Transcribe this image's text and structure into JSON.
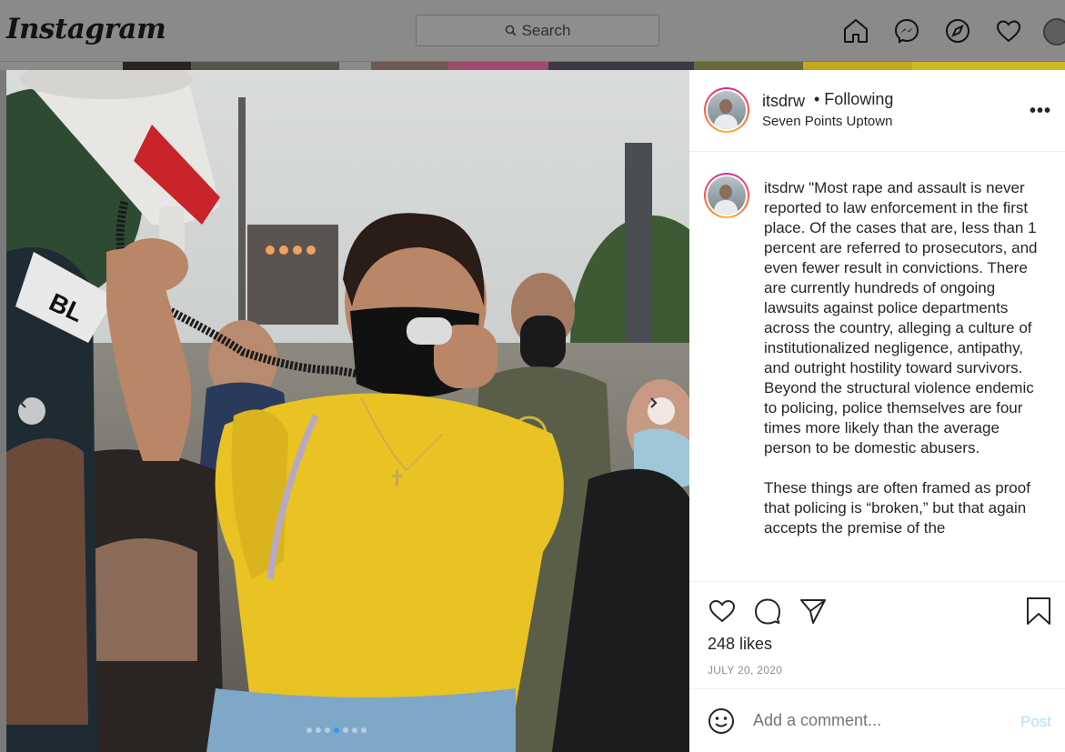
{
  "nav": {
    "logo": "Instagram",
    "search_placeholder": "Search",
    "icons": [
      "home-icon",
      "messenger-icon",
      "explore-icon",
      "heart-icon",
      "profile-avatar"
    ]
  },
  "post": {
    "username": "itsdrw",
    "following_label": "• Following",
    "location": "Seven Points Uptown",
    "more_label": "•••",
    "caption_username": "itsdrw",
    "caption_text": " \"Most rape and assault is never reported to law enforcement in the first place. Of the cases that are, less than 1 percent are referred to prosecutors, and even fewer result in convictions. There are currently hundreds of ongoing lawsuits against police departments across the country, alleging a culture of institutionalized negligence, antipathy, and outright hostility toward survivors. Beyond the structural violence endemic to policing, police themselves are four times more likely than the average person to be domestic abusers.\n\nThese things are often framed as proof that policing is “broken,” but that again accepts the premise of the",
    "likes": "248 likes",
    "date": "JULY 20, 2020",
    "comment_placeholder": "Add a comment...",
    "post_label": "Post",
    "carousel": {
      "count": 7,
      "active_index": 3
    }
  },
  "colors": {
    "link_blue": "#3897f0",
    "post_disabled": "#b2dffc",
    "story_ring": [
      "#d6249f",
      "#fd5949",
      "#fdb52b"
    ],
    "shirt_yellow": "#e8c323"
  }
}
